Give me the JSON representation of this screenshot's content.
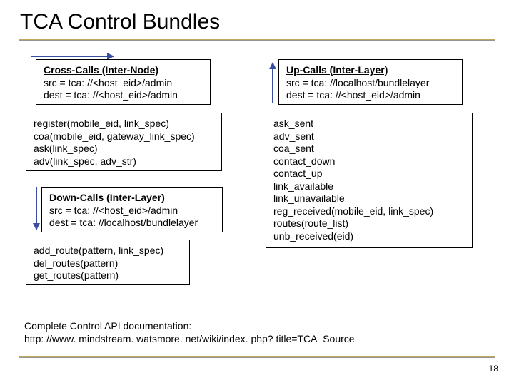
{
  "title": "TCA Control Bundles",
  "cross": {
    "hdr": "Cross-Calls (Inter-Node)",
    "src": "src = tca: //<host_eid>/admin",
    "dest": "dest = tca: //<host_eid>/admin"
  },
  "cross_list": {
    "l1": "register(mobile_eid, link_spec)",
    "l2": "coa(mobile_eid, gateway_link_spec)",
    "l3": "ask(link_spec)",
    "l4": "adv(link_spec, adv_str)"
  },
  "down": {
    "hdr": "Down-Calls (Inter-Layer)",
    "src": "src = tca: //<host_eid>/admin",
    "dest": "dest = tca: //localhost/bundlelayer"
  },
  "down_list": {
    "l1": "add_route(pattern, link_spec)",
    "l2": "del_routes(pattern)",
    "l3": "get_routes(pattern)"
  },
  "up": {
    "hdr": "Up-Calls (Inter-Layer)",
    "src": "src = tca: //localhost/bundlelayer",
    "dest": "dest = tca: //<host_eid>/admin"
  },
  "up_list": {
    "l1": "ask_sent",
    "l2": "adv_sent",
    "l3": "coa_sent",
    "l4": "contact_down",
    "l5": "contact_up",
    "l6": "link_available",
    "l7": "link_unavailable",
    "l8": "reg_received(mobile_eid, link_spec)",
    "l9": "routes(route_list)",
    "l10": "unb_received(eid)"
  },
  "footer": {
    "l1": "Complete Control API documentation:",
    "l2": "http: //www. mindstream. watsmore. net/wiki/index. php? title=TCA_Source"
  },
  "page": "18"
}
